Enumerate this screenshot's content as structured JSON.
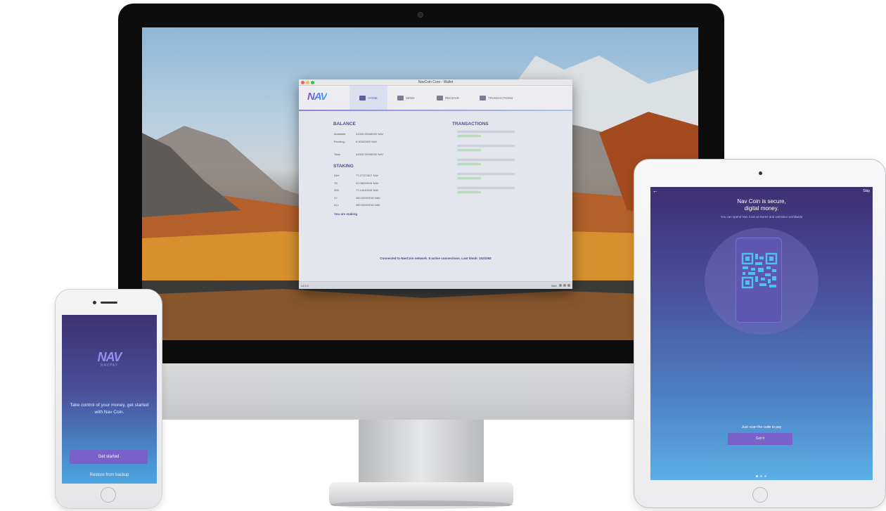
{
  "imac": {
    "wallet": {
      "window_title": "NavCoin Core - Wallet",
      "logo": "NAV",
      "nav": [
        {
          "label": "HOME",
          "icon": "home-icon"
        },
        {
          "label": "SEND",
          "icon": "send-icon"
        },
        {
          "label": "RECEIVE",
          "icon": "receive-icon"
        },
        {
          "label": "TRANSACTIONS",
          "icon": "transactions-icon"
        }
      ],
      "balance": {
        "title": "BALANCE",
        "rows": [
          {
            "label": "Available:",
            "value": "41000.00048000 NAV"
          },
          {
            "label": "Pending:",
            "value": "0.00000000 NAV"
          },
          {
            "label": "Total:",
            "value": "41000.00048000 NAV"
          }
        ]
      },
      "staking": {
        "title": "STAKING",
        "rows": [
          {
            "label": "24H",
            "value": "77.27227817 NAV"
          },
          {
            "label": "7D",
            "value": "22.08020016 NAV"
          },
          {
            "label": "30D",
            "value": "77.14040016 NAV"
          },
          {
            "label": "1Y",
            "value": "380.00000018 NAV"
          },
          {
            "label": "ALL",
            "value": "380.00000018 NAV"
          }
        ],
        "note": "You are staking"
      },
      "transactions_title": "TRANSACTIONS",
      "connection": "Connected to NavCoin network.   8 active connections.   Last block: 2431092",
      "status_left": "v4.0.0",
      "status_right": "NAV"
    }
  },
  "iphone": {
    "logo": "NAV",
    "sub": "NAVPAY",
    "message": "Take control of your money, get started with Nav Coin.",
    "primary_button": "Get started",
    "secondary_link": "Restore from backup"
  },
  "ipad": {
    "back": "←",
    "skip": "Skip",
    "title": "Nav Coin is secure, digital money.",
    "subtitle": "You can spend Nav Coin at stores and websites worldwide",
    "scan_text": "Just scan the code to pay",
    "button": "Got it"
  },
  "colors": {
    "brand_purple": "#7a60c9",
    "brand_blue": "#4ca6e0",
    "wallet_heading": "#4a4f9a"
  }
}
